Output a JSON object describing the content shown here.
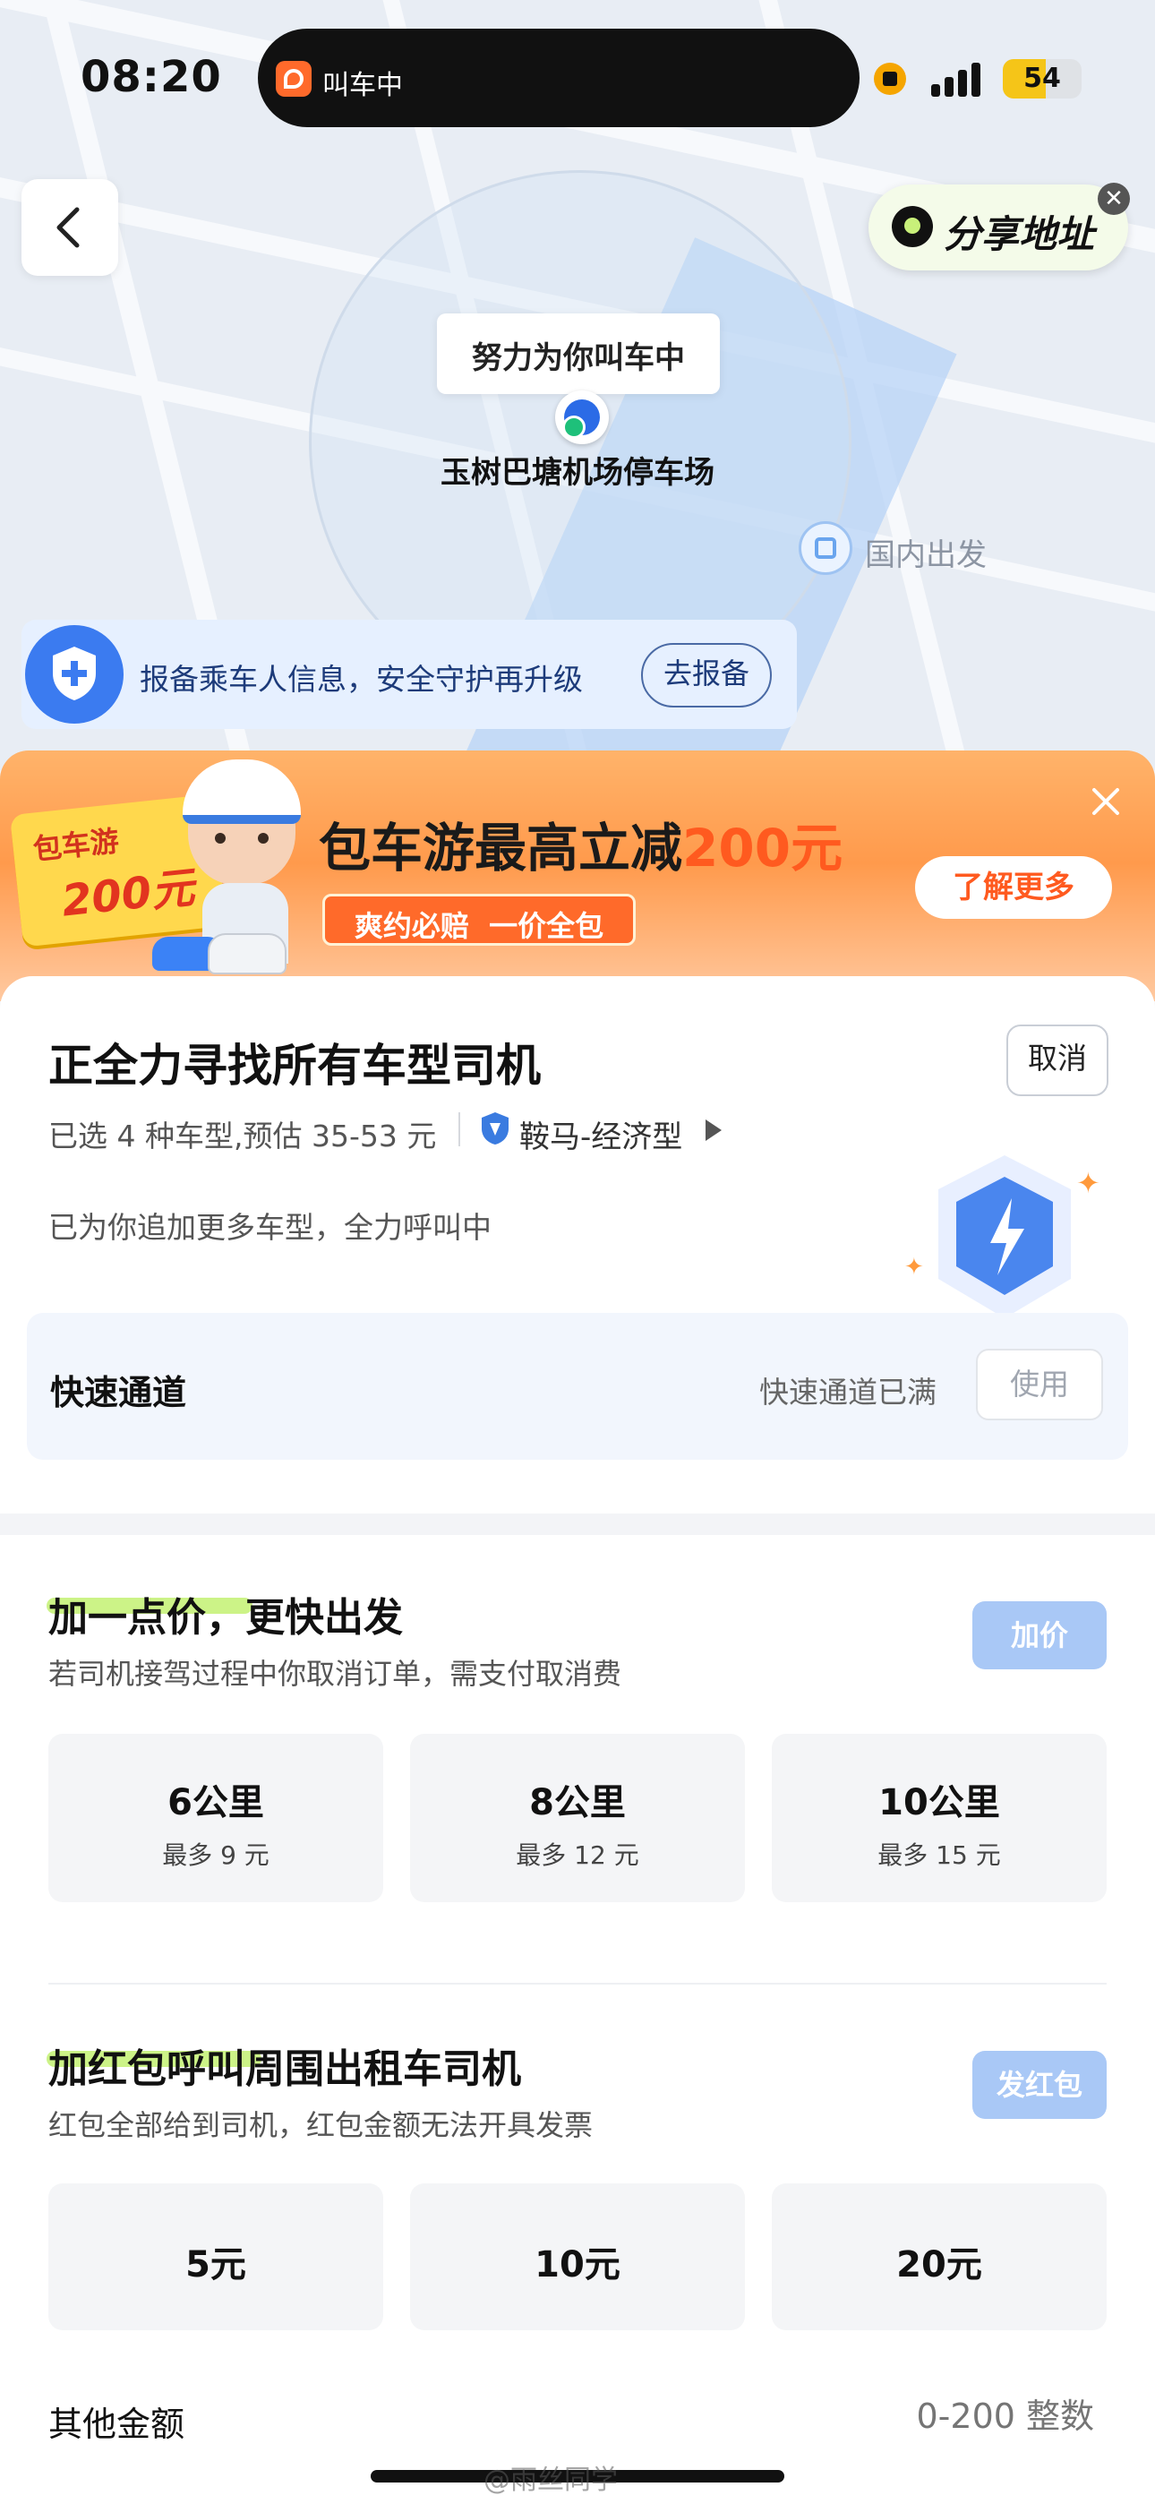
{
  "status_bar": {
    "time": "08:20",
    "island_text": "叫车中",
    "battery": "54",
    "battery_level": 0.54
  },
  "map": {
    "back_icon": "chevron-left-icon",
    "share_label": "分享地址",
    "bubble_text": "努力为你叫车中",
    "location_name": "玉树巴塘机场停车场",
    "poi_label": "国内出发"
  },
  "safety_banner": {
    "text": "报备乘车人信息，安全守护再升级",
    "button": "去报备"
  },
  "promo": {
    "badge_top": "包车游",
    "badge_amount": "200元",
    "headline_prefix": "包车游最高立减",
    "headline_amount": "200元",
    "tags": "爽约必赔  一价全包",
    "learn_more": "了解更多"
  },
  "search": {
    "title": "正全力寻找所有车型司机",
    "cancel": "取消",
    "summary": "已选 4 种车型,预估 35-53 元",
    "brand": "鞍马-经济型",
    "subtitle": "已为你追加更多车型，全力呼叫中"
  },
  "fast_lane": {
    "label": "快速通道",
    "status": "快速通道已满",
    "button": "使用"
  },
  "add_price": {
    "title": "加一点价，更快出发",
    "desc": "若司机接驾过程中你取消订单，需支付取消费",
    "button": "加价",
    "options": [
      {
        "distance": "6公里",
        "max": "最多 9 元"
      },
      {
        "distance": "8公里",
        "max": "最多 12 元"
      },
      {
        "distance": "10公里",
        "max": "最多 15 元"
      }
    ]
  },
  "red_packet": {
    "title": "加红包呼叫周围出租车司机",
    "desc": "红包全部给到司机，红包金额无法开具发票",
    "button": "发红包",
    "options": [
      "5元",
      "10元",
      "20元"
    ]
  },
  "other_amount": {
    "label": "其他金额",
    "placeholder": "0-200 整数"
  },
  "watermark": "@雨丝同学"
}
